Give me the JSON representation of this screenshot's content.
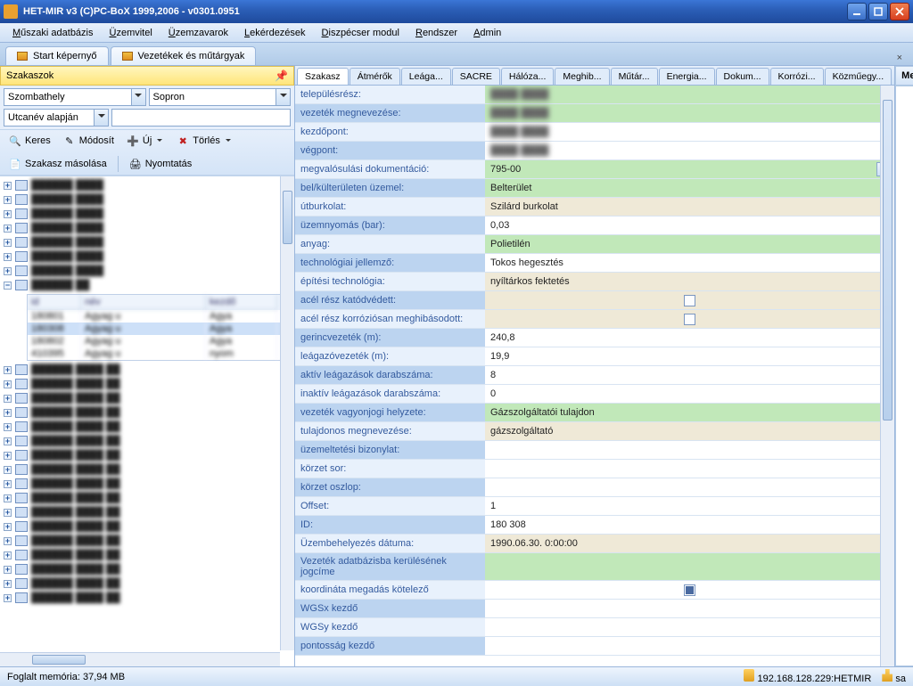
{
  "window": {
    "title": "HET-MIR v3 (C)PC-BoX 1999,2006 - v0301.0951"
  },
  "menu": [
    "Műszaki adatbázis",
    "Üzemvitel",
    "Üzemzavarok",
    "Lekérdezések",
    "Diszpécser modul",
    "Rendszer",
    "Admin"
  ],
  "doctabs": [
    "Start képernyő",
    "Vezetékek és műtárgyak"
  ],
  "left": {
    "header": "Szakaszok",
    "city1": "Szombathely",
    "city2": "Sopron",
    "filterMode": "Utcanév alapján",
    "toolbar": {
      "keres": "Keres",
      "modosit": "Módosít",
      "uj": "Új",
      "torles": "Törlés",
      "masolas": "Szakasz másolása",
      "nyomtatas": "Nyomtatás"
    },
    "subgridHeaders": [
      "id",
      "név",
      "kezdő"
    ],
    "subgridRows": [
      [
        "180801",
        "Agyag u",
        "Agya"
      ],
      [
        "180308",
        "Agyag u",
        "Agya"
      ],
      [
        "180802",
        "Agyag u",
        "Agya"
      ],
      [
        "410395",
        "Agyag u",
        "nyom"
      ]
    ]
  },
  "center": {
    "tabs": [
      "Szakasz",
      "Átmérők",
      "Leága...",
      "SACRE",
      "Hálóza...",
      "Meghib...",
      "Műtár...",
      "Energia...",
      "Dokum...",
      "Korrózi...",
      "Közműegy..."
    ],
    "rows": [
      {
        "label": "településrész:",
        "value": "",
        "cls": "green",
        "blur": true
      },
      {
        "label": "vezeték megnevezése:",
        "value": "",
        "cls": "green",
        "blur": true
      },
      {
        "label": "kezdőpont:",
        "value": "",
        "cls": "",
        "blur": true
      },
      {
        "label": "végpont:",
        "value": "",
        "cls": "",
        "blur": true
      },
      {
        "label": "megvalósulási dokumentáció:",
        "value": "795-00",
        "cls": "green",
        "more": true
      },
      {
        "label": "bel/külterületen üzemel:",
        "value": "Belterület",
        "cls": "green"
      },
      {
        "label": "útburkolat:",
        "value": "Szilárd burkolat",
        "cls": "beige"
      },
      {
        "label": "üzemnyomás (bar):",
        "value": "0,03",
        "cls": ""
      },
      {
        "label": "anyag:",
        "value": "Polietilén",
        "cls": "green"
      },
      {
        "label": "technológiai jellemző:",
        "value": "Tokos hegesztés",
        "cls": ""
      },
      {
        "label": "építési technológia:",
        "value": "nyíltárkos fektetés",
        "cls": "beige"
      },
      {
        "label": "acél rész katódvédett:",
        "value": "",
        "cls": "beige",
        "check": ""
      },
      {
        "label": "acél rész korróziósan meghibásodott:",
        "value": "",
        "cls": "beige",
        "check": ""
      },
      {
        "label": "gerincvezeték (m):",
        "value": "240,8",
        "cls": ""
      },
      {
        "label": "leágazóvezeték (m):",
        "value": "19,9",
        "cls": ""
      },
      {
        "label": "aktív leágazások darabszáma:",
        "value": "8",
        "cls": ""
      },
      {
        "label": "inaktív leágazások darabszáma:",
        "value": "0",
        "cls": ""
      },
      {
        "label": "vezeték vagyonjogi helyzete:",
        "value": "Gázszolgáltatói tulajdon",
        "cls": "green"
      },
      {
        "label": "tulajdonos megnevezése:",
        "value": "gázszolgáltató",
        "cls": "beige"
      },
      {
        "label": "üzemeltetési bizonylat:",
        "value": "",
        "cls": ""
      },
      {
        "label": "körzet sor:",
        "value": "",
        "cls": ""
      },
      {
        "label": "körzet oszlop:",
        "value": "",
        "cls": ""
      },
      {
        "label": "Offset:",
        "value": "1",
        "cls": ""
      },
      {
        "label": "ID:",
        "value": "180 308",
        "cls": ""
      },
      {
        "label": "Üzembehelyezés dátuma:",
        "value": "1990.06.30. 0:00:00",
        "cls": "beige"
      },
      {
        "label": "Vezeték adatbázisba kerülésének jogcíme",
        "value": "",
        "cls": "green"
      },
      {
        "label": "koordináta megadás kötelező",
        "value": "",
        "cls": "",
        "check": "checked"
      },
      {
        "label": "WGSx kezdő",
        "value": "",
        "cls": ""
      },
      {
        "label": "WGSy kezdő",
        "value": "",
        "cls": ""
      },
      {
        "label": "pontosság kezdő",
        "value": "",
        "cls": ""
      }
    ]
  },
  "right": {
    "header": "Megjegyzések"
  },
  "status": {
    "memory": "Foglalt memória: 37,94 MB",
    "server": "192.168.128.229:HETMIR",
    "user": "sa"
  }
}
